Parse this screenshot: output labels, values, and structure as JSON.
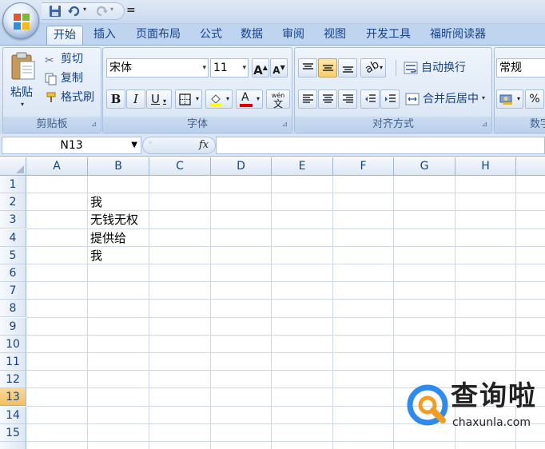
{
  "qat": {
    "customize_glyph": "="
  },
  "tabs": [
    "开始",
    "插入",
    "页面布局",
    "公式",
    "数据",
    "审阅",
    "视图",
    "开发工具",
    "福昕阅读器"
  ],
  "clipboard": {
    "paste": "粘贴",
    "cut": "剪切",
    "copy": "复制",
    "format_painter": "格式刷",
    "group_label": "剪贴板"
  },
  "font": {
    "name": "宋体",
    "size": "11",
    "bold": "B",
    "italic": "I",
    "underline": "U",
    "group_label": "字体",
    "phonetic": "wén"
  },
  "alignment": {
    "wrap": "自动换行",
    "merge": "合并后居中",
    "group_label": "对齐方式"
  },
  "number": {
    "format": "常规",
    "percent": "%",
    "group_label": "数字"
  },
  "formula_bar": {
    "name_box": "N13",
    "fx": "fx"
  },
  "columns": [
    "A",
    "B",
    "C",
    "D",
    "E",
    "F",
    "G",
    "H"
  ],
  "rows": [
    "1",
    "2",
    "3",
    "4",
    "5",
    "6",
    "7",
    "8",
    "9",
    "10",
    "11",
    "12",
    "13",
    "14",
    "15"
  ],
  "selected_row": "13",
  "cells": {
    "B2": "我",
    "B3": "无钱无权",
    "B4": "提供给",
    "B5": "我"
  },
  "watermark": {
    "title": "查询啦",
    "url": "chaxunla.com"
  }
}
